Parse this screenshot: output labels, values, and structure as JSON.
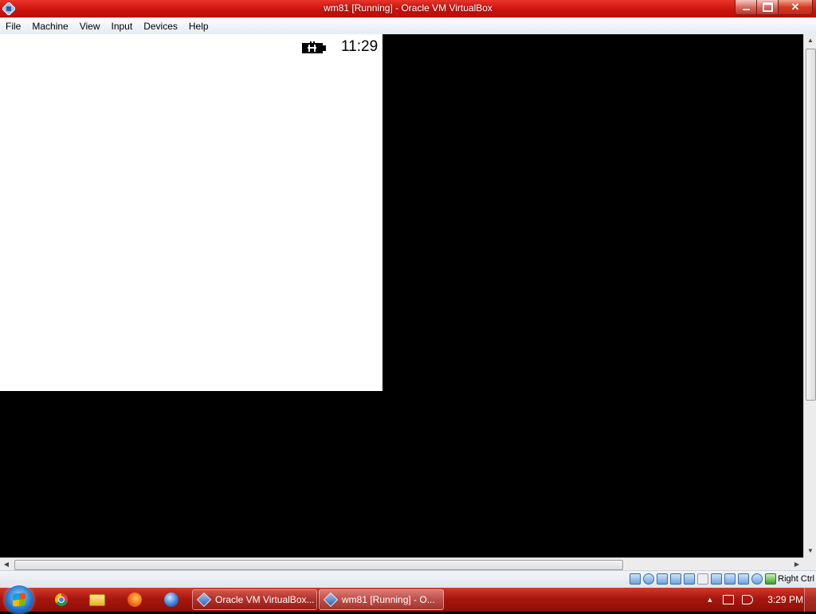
{
  "window": {
    "title": "wm81 [Running] - Oracle VM VirtualBox",
    "app_icon": "virtualbox-icon",
    "controls": {
      "minimize": "minimize-icon",
      "maximize": "restore-icon",
      "close": "✕"
    }
  },
  "menu": {
    "items": [
      "File",
      "Machine",
      "View",
      "Input",
      "Devices",
      "Help"
    ]
  },
  "guest": {
    "clock": "11:29",
    "battery_icon": "battery-charging-icon"
  },
  "statusbar": {
    "icons": [
      "hard-disk-icon",
      "optical-drive-icon",
      "audio-icon",
      "network-icon",
      "usb-icon",
      "shared-folders-icon",
      "display-icon",
      "capture-icon",
      "video-capture-icon",
      "virtualization-icon",
      "mouse-integration-icon"
    ],
    "host_key": "Right Ctrl"
  },
  "taskbar": {
    "start_icon": "windows-start-icon",
    "pinned": [
      "chrome-icon",
      "explorer-folder-icon",
      "firefox-icon",
      "browser-icon"
    ],
    "tasks": [
      {
        "label": "Oracle VM VirtualBox...",
        "icon": "virtualbox-icon"
      },
      {
        "label": "wm81 [Running] - O...",
        "icon": "virtualbox-icon"
      }
    ],
    "tray": {
      "show_hidden": "▲",
      "clock": "3:29 PM"
    }
  }
}
